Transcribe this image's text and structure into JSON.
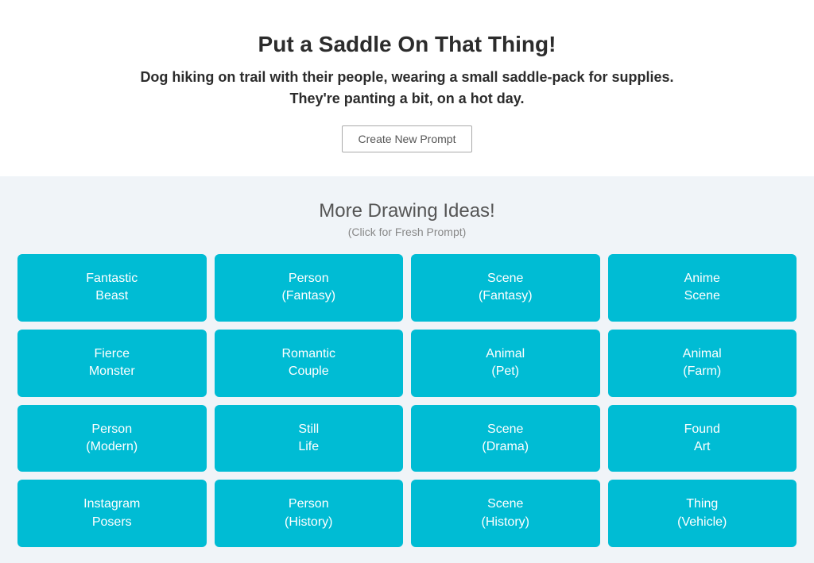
{
  "header": {
    "main_title": "Put a Saddle On That Thing!",
    "subtitle_line1": "Dog hiking on trail with their people, wearing a small saddle-pack for supplies.",
    "subtitle_line2": "They're panting a bit, on a hot day.",
    "create_btn_label": "Create New Prompt"
  },
  "ideas": {
    "section_title": "More Drawing Ideas!",
    "section_subtitle": "(Click for Fresh Prompt)",
    "cards": [
      {
        "label": "Fantastic\nBeast"
      },
      {
        "label": "Person\n(Fantasy)"
      },
      {
        "label": "Scene\n(Fantasy)"
      },
      {
        "label": "Anime\nScene"
      },
      {
        "label": "Fierce\nMonster"
      },
      {
        "label": "Romantic\nCouple"
      },
      {
        "label": "Animal\n(Pet)"
      },
      {
        "label": "Animal\n(Farm)"
      },
      {
        "label": "Person\n(Modern)"
      },
      {
        "label": "Still\nLife"
      },
      {
        "label": "Scene\n(Drama)"
      },
      {
        "label": "Found\nArt"
      },
      {
        "label": "Instagram\nPosers"
      },
      {
        "label": "Person\n(History)"
      },
      {
        "label": "Scene\n(History)"
      },
      {
        "label": "Thing\n(Vehicle)"
      }
    ]
  }
}
